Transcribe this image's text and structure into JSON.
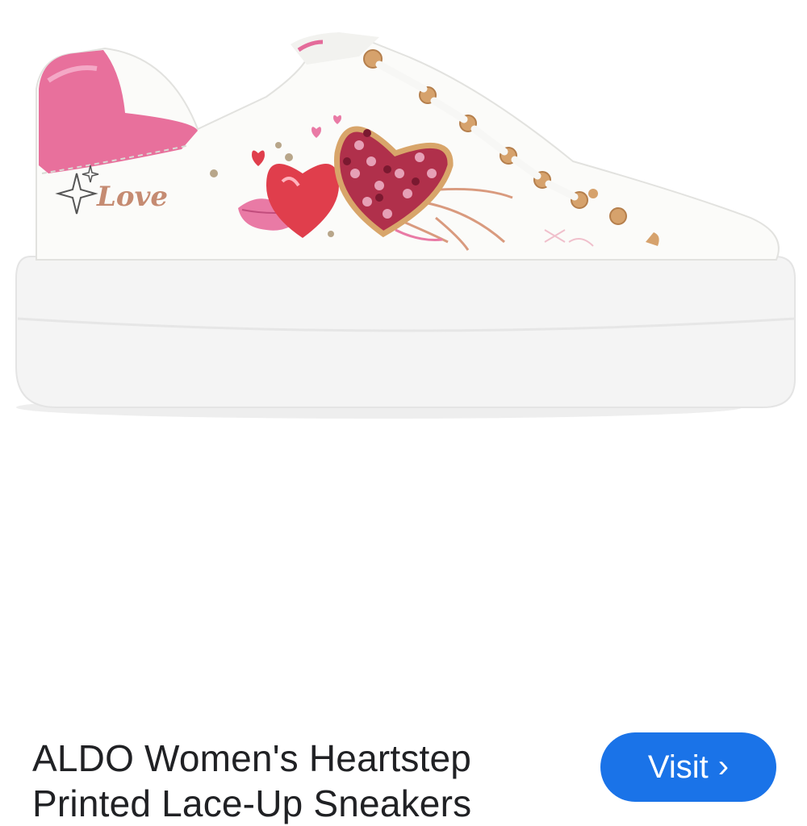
{
  "product": {
    "title": "ALDO Women's Heartstep Printed Lace-Up Sneakers",
    "image_alt": "White platform lace-up sneaker with heart print and rhinestone heart",
    "embroidery_text": "Love"
  },
  "actions": {
    "visit_label": "Visit",
    "visit_icon": "chevron-right-icon"
  },
  "colors": {
    "accent": "#1a73e8",
    "title_text": "#202124",
    "heel_pink": "#e8709c"
  }
}
